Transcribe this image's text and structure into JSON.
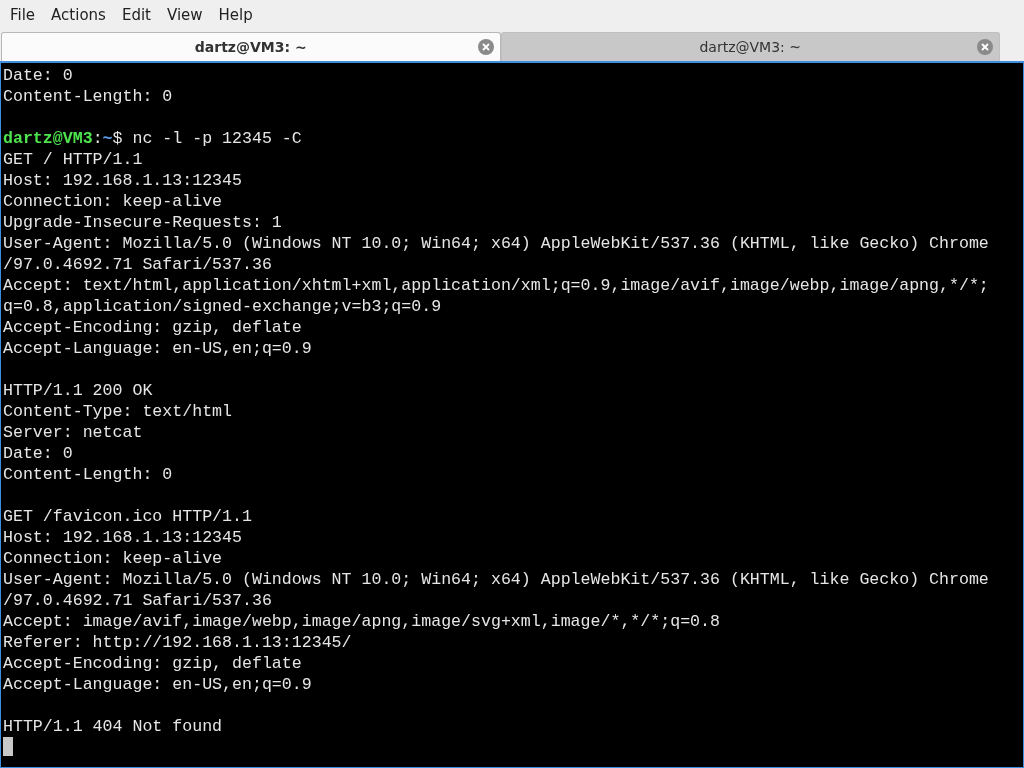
{
  "menu": [
    "File",
    "Actions",
    "Edit",
    "View",
    "Help"
  ],
  "tabs": [
    {
      "title": "dartz@VM3: ~",
      "selected": true
    },
    {
      "title": "dartz@VM3: ~",
      "selected": false
    }
  ],
  "terminal": {
    "lines": [
      {
        "kind": "output",
        "text": "Date: 0"
      },
      {
        "kind": "output",
        "text": "Content-Length: 0"
      },
      {
        "kind": "blank"
      },
      {
        "kind": "prompt",
        "user_host": "dartz@VM3",
        "separator": ":",
        "path": "~",
        "symbol": "$",
        "command": " nc -l -p 12345 -C"
      },
      {
        "kind": "output",
        "text": "GET / HTTP/1.1"
      },
      {
        "kind": "output",
        "text": "Host: 192.168.1.13:12345"
      },
      {
        "kind": "output",
        "text": "Connection: keep-alive"
      },
      {
        "kind": "output",
        "text": "Upgrade-Insecure-Requests: 1"
      },
      {
        "kind": "output",
        "text": "User-Agent: Mozilla/5.0 (Windows NT 10.0; Win64; x64) AppleWebKit/537.36 (KHTML, like Gecko) Chrome"
      },
      {
        "kind": "output",
        "text": "/97.0.4692.71 Safari/537.36"
      },
      {
        "kind": "output",
        "text": "Accept: text/html,application/xhtml+xml,application/xml;q=0.9,image/avif,image/webp,image/apng,*/*;"
      },
      {
        "kind": "output",
        "text": "q=0.8,application/signed-exchange;v=b3;q=0.9"
      },
      {
        "kind": "output",
        "text": "Accept-Encoding: gzip, deflate"
      },
      {
        "kind": "output",
        "text": "Accept-Language: en-US,en;q=0.9"
      },
      {
        "kind": "blank"
      },
      {
        "kind": "output",
        "text": "HTTP/1.1 200 OK"
      },
      {
        "kind": "output",
        "text": "Content-Type: text/html"
      },
      {
        "kind": "output",
        "text": "Server: netcat"
      },
      {
        "kind": "output",
        "text": "Date: 0"
      },
      {
        "kind": "output",
        "text": "Content-Length: 0"
      },
      {
        "kind": "blank"
      },
      {
        "kind": "output",
        "text": "GET /favicon.ico HTTP/1.1"
      },
      {
        "kind": "output",
        "text": "Host: 192.168.1.13:12345"
      },
      {
        "kind": "output",
        "text": "Connection: keep-alive"
      },
      {
        "kind": "output",
        "text": "User-Agent: Mozilla/5.0 (Windows NT 10.0; Win64; x64) AppleWebKit/537.36 (KHTML, like Gecko) Chrome"
      },
      {
        "kind": "output",
        "text": "/97.0.4692.71 Safari/537.36"
      },
      {
        "kind": "output",
        "text": "Accept: image/avif,image/webp,image/apng,image/svg+xml,image/*,*/*;q=0.8"
      },
      {
        "kind": "output",
        "text": "Referer: http://192.168.1.13:12345/"
      },
      {
        "kind": "output",
        "text": "Accept-Encoding: gzip, deflate"
      },
      {
        "kind": "output",
        "text": "Accept-Language: en-US,en;q=0.9"
      },
      {
        "kind": "blank"
      },
      {
        "kind": "output",
        "text": "HTTP/1.1 404 Not found"
      },
      {
        "kind": "cursor"
      }
    ]
  }
}
